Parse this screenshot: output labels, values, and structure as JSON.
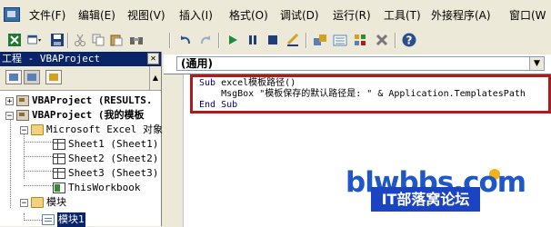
{
  "menubar": {
    "items": [
      "文件(F)",
      "编辑(E)",
      "视图(V)",
      "插入(I)",
      "格式(O)",
      "调试(D)",
      "运行(R)",
      "工具(T)",
      "外接程序(A)",
      "窗口(W"
    ]
  },
  "toolbar": {
    "buttons": [
      "view-excel-icon",
      "insert-userform-icon",
      "save-icon",
      "cut-icon",
      "copy-icon",
      "paste-icon",
      "find-icon",
      "undo-icon",
      "redo-icon",
      "run-icon",
      "break-icon",
      "reset-icon",
      "design-mode-icon",
      "project-explorer-icon",
      "properties-icon",
      "object-browser-icon",
      "toolbox-icon",
      "help-icon"
    ]
  },
  "project_panel": {
    "title": "工程 - VBAProject",
    "tree": [
      {
        "label": "VBAProject (RESULTS.",
        "bold": true
      },
      {
        "label": "VBAProject (我的模板",
        "bold": true
      },
      {
        "label": "Microsoft Excel 对象"
      },
      {
        "label": "Sheet1 (Sheet1)"
      },
      {
        "label": "Sheet2 (Sheet2)"
      },
      {
        "label": "Sheet3 (Sheet3)"
      },
      {
        "label": "ThisWorkbook"
      },
      {
        "label": "模块"
      },
      {
        "label": "模块1",
        "selected": true
      }
    ]
  },
  "code_window": {
    "object_combo": "(通用)",
    "lines": [
      {
        "kw": "Sub",
        "rest": " excel模板路径()"
      },
      {
        "kw": "",
        "rest": "    MsgBox \"模板保存的默认路径是: \" & Application.TemplatesPath"
      },
      {
        "kw": "End Sub",
        "rest": ""
      }
    ]
  },
  "watermark": {
    "site": "blwbbs.com",
    "forum": "IT部落窝论坛"
  },
  "colors": {
    "title_bar": "#0a246a",
    "highlight_box": "#b51818",
    "watermark_blue": "#1a44c2"
  }
}
